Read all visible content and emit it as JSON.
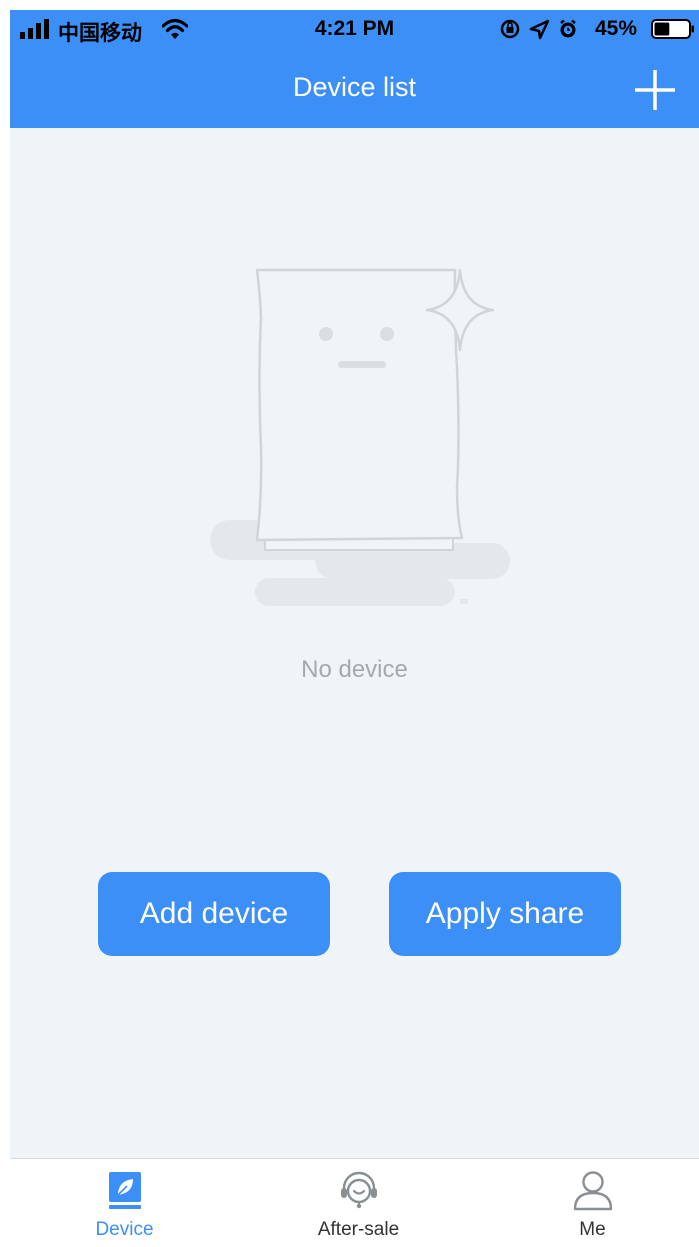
{
  "status_bar": {
    "carrier": "中国移动",
    "time": "4:21 PM",
    "battery_percent": "45%",
    "battery_level": 0.45,
    "icons": [
      "signal-icon",
      "wifi-icon",
      "orientation-lock-icon",
      "location-icon",
      "alarm-icon",
      "battery-icon"
    ]
  },
  "header": {
    "title": "Device list",
    "add_icon": "plus-icon"
  },
  "empty_state": {
    "illustration": "empty-device-illustration",
    "message": "No device"
  },
  "actions": {
    "add_device": "Add device",
    "apply_share": "Apply share"
  },
  "tabs": [
    {
      "label": "Device",
      "icon": "device-leaf-icon",
      "active": true
    },
    {
      "label": "After-sale",
      "icon": "headset-icon",
      "active": false
    },
    {
      "label": "Me",
      "icon": "user-icon",
      "active": false
    }
  ],
  "colors": {
    "primary": "#3b8ff7",
    "background": "#f0f4f6",
    "muted_text": "#a3a9ae"
  }
}
